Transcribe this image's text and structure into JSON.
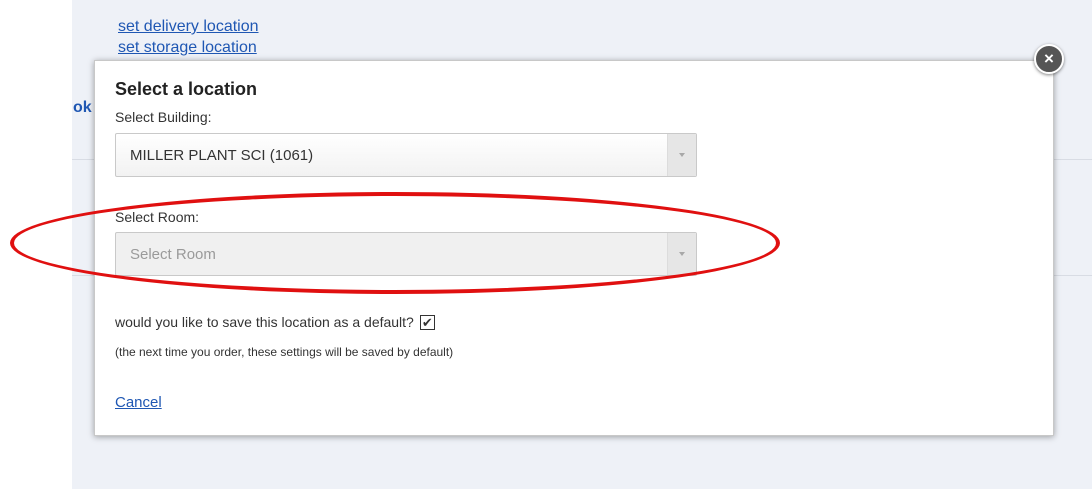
{
  "background": {
    "links": [
      "set delivery location",
      "set storage location"
    ],
    "cut_text": "ok"
  },
  "modal": {
    "title": "Select a location",
    "building": {
      "label": "Select Building:",
      "value": "MILLER PLANT SCI (1061)"
    },
    "room": {
      "label": "Select Room:",
      "value": "Select Room"
    },
    "default_question": "would you like to save this location as a default?",
    "default_checked": true,
    "checkmark": "✔",
    "hint": "(the next time you order, these settings will be saved by default)",
    "cancel_label": "Cancel",
    "close_symbol": "×"
  },
  "colors": {
    "link": "#1f57b3",
    "highlight": "#e01010"
  },
  "icons": {
    "close": "close-icon",
    "dropdown": "chevron-down-icon",
    "check": "checkmark-icon"
  }
}
